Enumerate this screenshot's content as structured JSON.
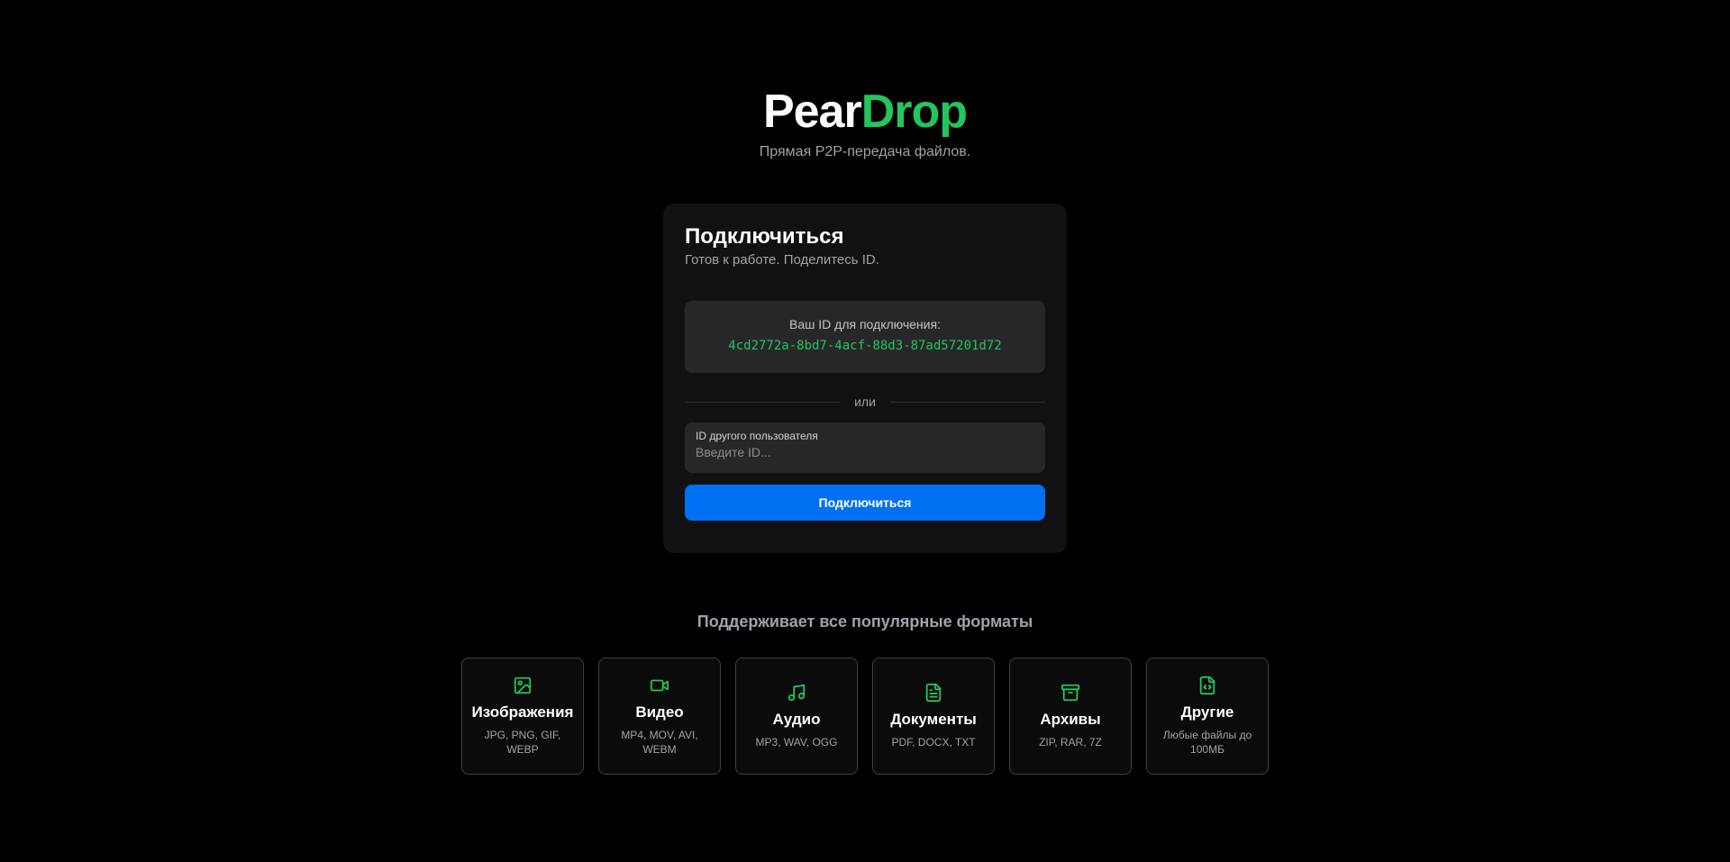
{
  "header": {
    "logo_part1": "Pear",
    "logo_part2": "Drop",
    "tagline": "Прямая P2P-передача файлов."
  },
  "connect_card": {
    "title": "Подключиться",
    "status": "Готов к работе. Поделитесь ID.",
    "your_id_label": "Ваш ID для подключения:",
    "your_id_value": "4cd2772a-8bd7-4acf-88d3-87ad57201d72",
    "divider_text": "или",
    "peer_input": {
      "label": "ID другого пользователя",
      "value": "",
      "placeholder": "Введите ID..."
    },
    "connect_button_label": "Подключиться"
  },
  "formats": {
    "title": "Поддерживает все популярные форматы",
    "items": [
      {
        "icon": "image-icon",
        "name": "Изображения",
        "desc": "JPG, PNG, GIF, WEBP"
      },
      {
        "icon": "video-icon",
        "name": "Видео",
        "desc": "MP4, MOV, AVI, WEBM"
      },
      {
        "icon": "music-icon",
        "name": "Аудио",
        "desc": "MP3, WAV, OGG"
      },
      {
        "icon": "document-icon",
        "name": "Документы",
        "desc": "PDF, DOCX, TXT"
      },
      {
        "icon": "archive-icon",
        "name": "Архивы",
        "desc": "ZIP, RAR, 7Z"
      },
      {
        "icon": "code-file-icon",
        "name": "Другие",
        "desc": "Любые файлы до 100МБ"
      }
    ]
  },
  "colors": {
    "accent_green": "#22c55e",
    "primary_blue": "#0070f3",
    "background": "#000000",
    "card_background": "#111113"
  }
}
